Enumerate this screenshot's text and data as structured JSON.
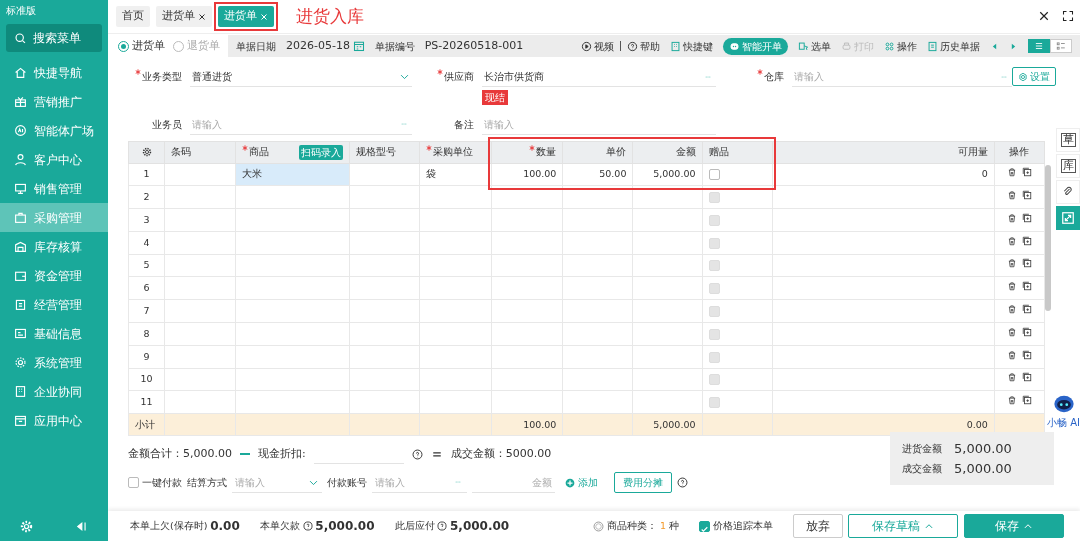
{
  "app": {
    "edition": "标准版"
  },
  "sidebar": {
    "search": "搜索菜单",
    "items": [
      {
        "label": "快捷导航",
        "selected": false
      },
      {
        "label": "营销推广",
        "selected": false
      },
      {
        "label": "智能体广场",
        "selected": false
      },
      {
        "label": "客户中心",
        "selected": false
      },
      {
        "label": "销售管理",
        "selected": false
      },
      {
        "label": "采购管理",
        "selected": true
      },
      {
        "label": "库存核算",
        "selected": false
      },
      {
        "label": "资金管理",
        "selected": false
      },
      {
        "label": "经营管理",
        "selected": false
      },
      {
        "label": "基础信息",
        "selected": false
      },
      {
        "label": "系统管理",
        "selected": false
      },
      {
        "label": "企业协同",
        "selected": false
      },
      {
        "label": "应用中心",
        "selected": false
      }
    ]
  },
  "tabs": [
    {
      "label": "首页",
      "selected": false,
      "closable": false,
      "highlighted": false
    },
    {
      "label": "进货单",
      "selected": false,
      "closable": true,
      "highlighted": false
    },
    {
      "label": "进货单",
      "selected": true,
      "closable": true,
      "highlighted": true
    }
  ],
  "annotation": {
    "text": "进货入库"
  },
  "toolbar": {
    "doc_types": [
      {
        "label": "进货单",
        "selected": true
      },
      {
        "label": "退货单",
        "selected": false
      }
    ],
    "date_label": "单据日期",
    "date": "2026-05-18",
    "number_label": "单据编号",
    "number": "PS-20260518-001",
    "actions": [
      {
        "label": "视频",
        "kind": "play",
        "disabled": false
      },
      {
        "label": "帮助",
        "kind": "help",
        "disabled": false
      },
      {
        "label": "快捷键",
        "kind": "keys",
        "disabled": false
      },
      {
        "label": "智能开单",
        "kind": "pill",
        "disabled": false
      },
      {
        "label": "选单",
        "kind": "pick",
        "disabled": false
      },
      {
        "label": "打印",
        "kind": "print",
        "disabled": true
      },
      {
        "label": "操作",
        "kind": "grid",
        "disabled": false
      },
      {
        "label": "历史单据",
        "kind": "history",
        "disabled": false
      }
    ],
    "view_modes": [
      {
        "kind": "list",
        "selected": true
      },
      {
        "kind": "detail",
        "selected": false
      }
    ]
  },
  "form": {
    "fields": [
      {
        "label": "业务类型",
        "required": true,
        "value": "普通进货",
        "kind": "select"
      },
      {
        "label": "供应商",
        "required": true,
        "value": "长治市供货商",
        "kind": "lookup",
        "tag": "现结"
      },
      {
        "label": "仓库",
        "required": true,
        "placeholder": "请输入",
        "kind": "lookup"
      },
      {
        "label": "业务员",
        "required": false,
        "placeholder": "请输入",
        "kind": "lookup"
      },
      {
        "label": "备注",
        "required": false,
        "placeholder": "请输入",
        "kind": "text"
      }
    ],
    "settings": "设置"
  },
  "table": {
    "amounts_highlighted": true,
    "columns": [
      {
        "label": "条码",
        "required": false
      },
      {
        "label": "商品",
        "required": true,
        "badge": "扫码录入"
      },
      {
        "label": "规格型号",
        "required": false
      },
      {
        "label": "采购单位",
        "required": true
      },
      {
        "label": "数量",
        "required": true
      },
      {
        "label": "单价",
        "required": false
      },
      {
        "label": "金额",
        "required": false
      },
      {
        "label": "赠品",
        "required": false
      },
      {
        "label": "可用量",
        "required": false
      },
      {
        "label": "操作",
        "required": false
      }
    ],
    "rows": [
      {
        "index": "1",
        "barcode": "",
        "product": "大米",
        "unit": "袋",
        "qty": "100.00",
        "price": "50.00",
        "amount": "5,000.00",
        "gift": false,
        "gift_disabled": false,
        "available": "0",
        "selected": true
      },
      {
        "index": "2",
        "gift": false,
        "gift_disabled": true,
        "selected": false
      },
      {
        "index": "3",
        "gift": false,
        "gift_disabled": true,
        "selected": false
      },
      {
        "index": "4",
        "gift": false,
        "gift_disabled": true,
        "selected": false
      },
      {
        "index": "5",
        "gift": false,
        "gift_disabled": true,
        "selected": false
      },
      {
        "index": "6",
        "gift": false,
        "gift_disabled": true,
        "selected": false
      },
      {
        "index": "7",
        "gift": false,
        "gift_disabled": true,
        "selected": false
      },
      {
        "index": "8",
        "gift": false,
        "gift_disabled": true,
        "selected": false
      },
      {
        "index": "9",
        "gift": false,
        "gift_disabled": true,
        "selected": false
      },
      {
        "index": "10",
        "gift": false,
        "gift_disabled": true,
        "selected": false
      },
      {
        "index": "11",
        "gift": false,
        "gift_disabled": true,
        "selected": false
      }
    ],
    "subtotal": {
      "label": "小计",
      "qty": "100.00",
      "amount": "5,000.00",
      "available": "0.00"
    }
  },
  "summary": {
    "total": "金额合计：5,000.00",
    "discount_label": "现金折扣:",
    "deal": "成交金额：5000.00"
  },
  "payment": {
    "one_click": {
      "label": "一键付款",
      "checked": false
    },
    "method_label": "结算方式",
    "method_placeholder": "请输入",
    "account_label": "付款账号",
    "account_placeholder": "请输入",
    "amount_placeholder": "金额",
    "add": "添加",
    "allocate": "费用分摊"
  },
  "totals_box": [
    {
      "label": "进货金额",
      "value": "5,000.00"
    },
    {
      "label": "成交金额",
      "value": "5,000.00"
    }
  ],
  "side_rail": [
    {
      "kind": "draft",
      "text": "草"
    },
    {
      "kind": "stock",
      "text": "库"
    },
    {
      "kind": "attach"
    },
    {
      "kind": "expand"
    }
  ],
  "assistant": {
    "label": "小畅 AI"
  },
  "footer": {
    "stats": [
      {
        "label": "本单上欠(保存时)",
        "value": "0.00",
        "help": false
      },
      {
        "label": "本单欠款",
        "value": "5,000.00",
        "help": true
      },
      {
        "label": "此后应付",
        "value": "5,000.00",
        "help": true
      }
    ],
    "kinds_label": "商品种类：",
    "kinds_count": "1",
    "kinds_unit": "种",
    "track": {
      "label": "价格追踪本单",
      "checked": true
    },
    "buttons": [
      {
        "label": "放弃",
        "kind": "plain"
      },
      {
        "label": "保存草稿",
        "kind": "outline"
      },
      {
        "label": "保存",
        "kind": "primary"
      }
    ]
  }
}
